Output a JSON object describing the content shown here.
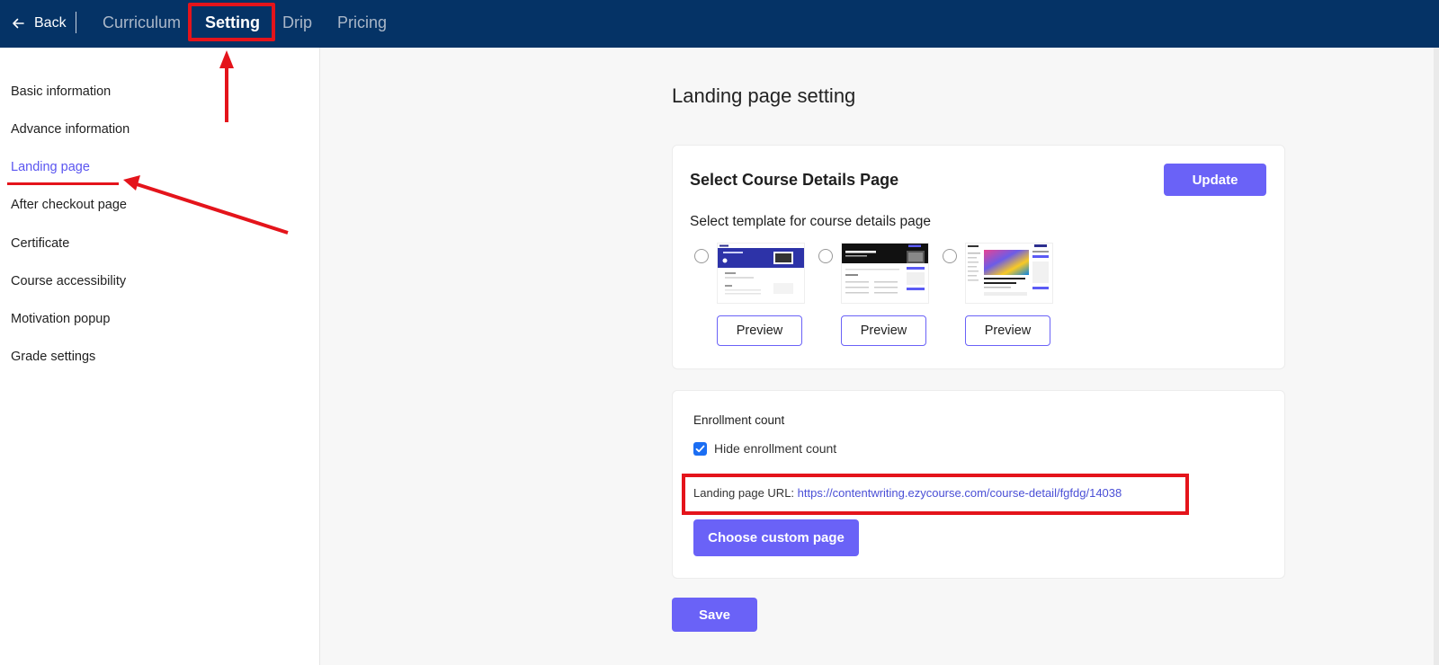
{
  "topbar": {
    "back_label": "Back",
    "tabs": [
      {
        "label": "Curriculum"
      },
      {
        "label": "Setting"
      },
      {
        "label": "Drip"
      },
      {
        "label": "Pricing"
      }
    ],
    "active_tab": "Setting"
  },
  "sidebar": {
    "items": [
      {
        "label": "Basic information"
      },
      {
        "label": "Advance information"
      },
      {
        "label": "Landing page"
      },
      {
        "label": "After checkout page"
      },
      {
        "label": "Certificate"
      },
      {
        "label": "Course accessibility"
      },
      {
        "label": "Motivation popup"
      },
      {
        "label": "Grade settings"
      }
    ],
    "active_item": "Landing page"
  },
  "main": {
    "title": "Landing page setting",
    "course_details": {
      "title": "Select Course Details Page",
      "update_label": "Update",
      "subtitle": "Select template for course details page",
      "templates": [
        {
          "preview_label": "Preview"
        },
        {
          "preview_label": "Preview"
        },
        {
          "preview_label": "Preview"
        }
      ]
    },
    "enrollment": {
      "title": "Enrollment count",
      "checkbox_label": "Hide enrollment count",
      "checked": true,
      "url_label": "Landing page URL:",
      "url": "https://contentwriting.ezycourse.com/course-detail/fgfdg/14038",
      "custom_page_label": "Choose custom page"
    },
    "save_label": "Save"
  },
  "colors": {
    "topbar": "#053366",
    "accent": "#6a62f7",
    "active_link": "#5a55f0",
    "annotation": "#e4141b",
    "checkbox": "#1b6ef3"
  },
  "icons": {
    "back": "arrow-left-icon",
    "check": "check-icon"
  }
}
